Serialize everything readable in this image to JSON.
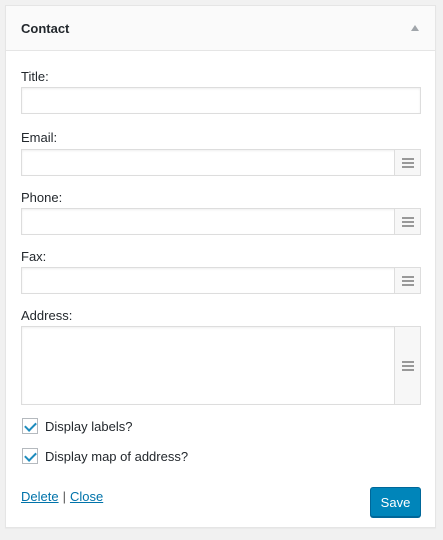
{
  "widget": {
    "title": "Contact",
    "toggle_icon": "triangle-up-icon"
  },
  "fields": {
    "title": {
      "label": "Title:",
      "value": ""
    },
    "email": {
      "label": "Email:",
      "value": ""
    },
    "phone": {
      "label": "Phone:",
      "value": ""
    },
    "fax": {
      "label": "Fax:",
      "value": ""
    },
    "address": {
      "label": "Address:",
      "value": ""
    }
  },
  "checkboxes": {
    "display_labels": {
      "label": "Display labels?",
      "checked": true
    },
    "display_map": {
      "label": "Display map of address?",
      "checked": true
    }
  },
  "actions": {
    "delete_label": "Delete",
    "separator": "|",
    "close_label": "Close",
    "save_label": "Save"
  },
  "colors": {
    "accent": "#0085ba",
    "link": "#0073aa",
    "check": "#1e8cbe"
  }
}
